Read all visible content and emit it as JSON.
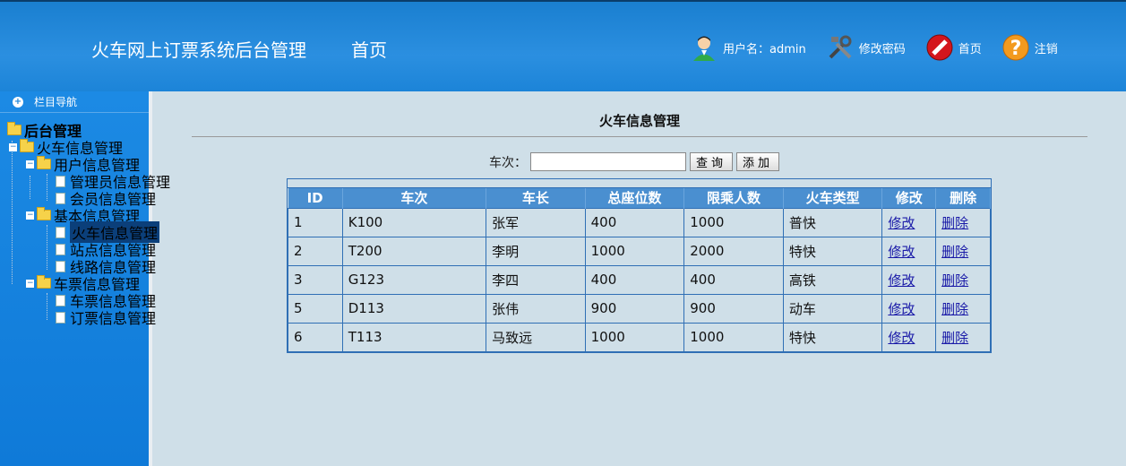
{
  "header": {
    "title": "火车网上订票系统后台管理",
    "home": "首页",
    "user": "用户名：admin",
    "change_password": "修改密码",
    "home_action": "首页",
    "logout": "注销"
  },
  "sidebar": {
    "nav_title": "栏目导航",
    "root": "后台管理",
    "groups": [
      {
        "label": "火车信息管理"
      },
      {
        "label": "用户信息管理",
        "items": [
          "管理员信息管理",
          "会员信息管理"
        ]
      },
      {
        "label": "基本信息管理",
        "items": [
          "火车信息管理",
          "站点信息管理",
          "线路信息管理"
        ]
      },
      {
        "label": "车票信息管理",
        "items": [
          "车票信息管理",
          "订票信息管理"
        ]
      }
    ]
  },
  "main": {
    "title": "火车信息管理",
    "search_label": "车次：",
    "search_value": "",
    "query_button": "查询",
    "add_button": "添加",
    "columns": [
      "ID",
      "车次",
      "车长",
      "总座位数",
      "限乘人数",
      "火车类型",
      "修改",
      "删除"
    ],
    "rows": [
      [
        "1",
        "K100",
        "张军",
        "400",
        "1000",
        "普快",
        "修改",
        "删除"
      ],
      [
        "2",
        "T200",
        "李明",
        "1000",
        "2000",
        "特快",
        "修改",
        "删除"
      ],
      [
        "3",
        "G123",
        "李四",
        "400",
        "400",
        "高铁",
        "修改",
        "删除"
      ],
      [
        "5",
        "D113",
        "张伟",
        "900",
        "900",
        "动车",
        "修改",
        "删除"
      ],
      [
        "6",
        "T113",
        "马致远",
        "1000",
        "1000",
        "特快",
        "修改",
        "删除"
      ]
    ]
  },
  "icons": {
    "user": "user-avatar-icon",
    "password": "tools-icon",
    "home": "stop-sign-icon",
    "logout": "question-icon"
  }
}
